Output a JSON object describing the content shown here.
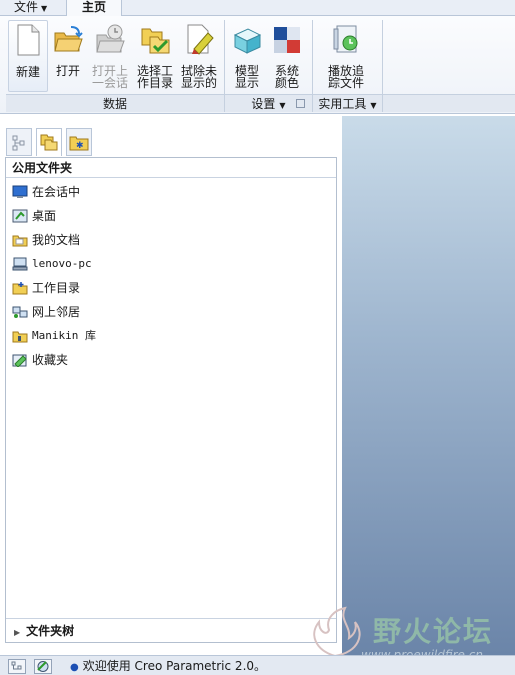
{
  "menu": {
    "file_label": "文件",
    "home_label": "主页"
  },
  "ribbon": {
    "buttons": {
      "new": "新建",
      "open": "打开",
      "open_last_line1": "打开上",
      "open_last_line2": "一会话",
      "select_dir_line1": "选择工",
      "select_dir_line2": "作目录",
      "erase_line1": "拭除未",
      "erase_line2": "显示的",
      "model_line1": "模型",
      "model_line2": "显示",
      "color_line1": "系统",
      "color_line2": "颜色",
      "playback_line1": "播放追",
      "playback_line2": "踪文件"
    },
    "groups": {
      "data": "数据",
      "settings": "设置",
      "utilities": "实用工具"
    }
  },
  "navigator": {
    "common_folders_title": "公用文件夹",
    "items": [
      {
        "label": "在会话中",
        "icon": "monitor-icon"
      },
      {
        "label": "桌面",
        "icon": "desktop-icon"
      },
      {
        "label": "我的文档",
        "icon": "documents-folder-icon"
      },
      {
        "label": "lenovo-pc",
        "icon": "computer-icon"
      },
      {
        "label": "工作目录",
        "icon": "working-dir-icon"
      },
      {
        "label": "网上邻居",
        "icon": "network-icon"
      },
      {
        "label": "Manikin 库",
        "icon": "library-folder-icon"
      },
      {
        "label": "收藏夹",
        "icon": "favorites-icon"
      }
    ],
    "folder_tree_label": "文件夹树"
  },
  "watermark": {
    "title": "野火论坛",
    "url": "www.proewildfire.cn"
  },
  "status": {
    "message": "欢迎使用 Creo Parametric 2.0。"
  },
  "colors": {
    "accent": "#1c4fb3",
    "graphics_top": "#c9dbe9",
    "graphics_bottom": "#6a84a8"
  }
}
